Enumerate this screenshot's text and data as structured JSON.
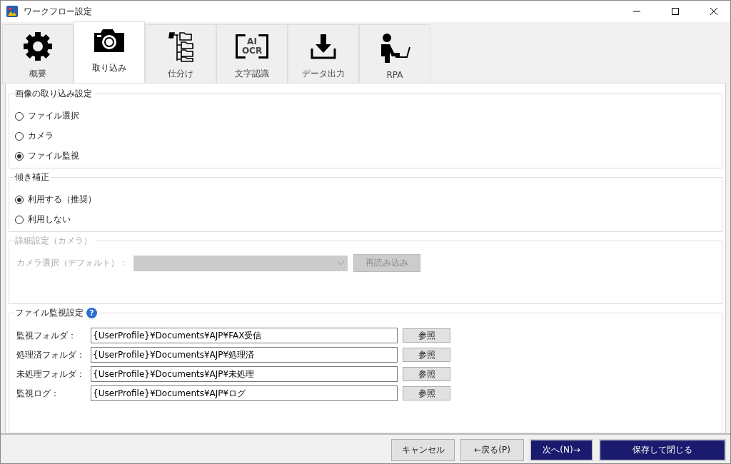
{
  "window": {
    "title": "ワークフロー設定"
  },
  "tabs": [
    {
      "label": "概要",
      "selected": false
    },
    {
      "label": "取り込み",
      "selected": true
    },
    {
      "label": "仕分け",
      "selected": false
    },
    {
      "label": "文字認識",
      "selected": false,
      "icon_text": [
        "AI",
        "OCR"
      ]
    },
    {
      "label": "データ出力",
      "selected": false
    },
    {
      "label": "RPA",
      "selected": false
    }
  ],
  "groups": [
    {
      "kind": "radio",
      "title": "画像の取り込み設定",
      "disabled": false,
      "options": [
        {
          "label": "ファイル選択",
          "selected": false
        },
        {
          "label": "カメラ",
          "selected": false
        },
        {
          "label": "ファイル監視",
          "selected": true
        }
      ]
    },
    {
      "kind": "radio",
      "title": "傾き補正",
      "disabled": false,
      "options": [
        {
          "label": "利用する（推奨）",
          "selected": true
        },
        {
          "label": "利用しない",
          "selected": false
        }
      ]
    },
    {
      "kind": "camera",
      "title": "詳細設定（カメラ）",
      "disabled": true,
      "camera_label": "カメラ選択（デフォルト）：",
      "reload_button": "再読み込み"
    },
    {
      "kind": "folders",
      "title": "ファイル監視設定",
      "disabled": false,
      "help": "?",
      "rows": [
        {
          "label": "監視フォルダ：",
          "value": "{UserProfile}¥Documents¥AJP¥FAX受信",
          "button": "参照"
        },
        {
          "label": "処理済フォルダ：",
          "value": "{UserProfile}¥Documents¥AJP¥処理済",
          "button": "参照"
        },
        {
          "label": "未処理フォルダ：",
          "value": "{UserProfile}¥Documents¥AJP¥未処理",
          "button": "参照"
        },
        {
          "label": "監視ログ：",
          "value": "{UserProfile}¥Documents¥AJP¥ログ",
          "button": "参照"
        }
      ]
    }
  ],
  "buttons": [
    {
      "label": "キャンセル",
      "kind": "normal"
    },
    {
      "label": "←戻る(P)",
      "kind": "normal"
    },
    {
      "label": "次へ(N)→",
      "kind": "primary"
    },
    {
      "label": "保存して閉じる",
      "kind": "primary"
    }
  ]
}
